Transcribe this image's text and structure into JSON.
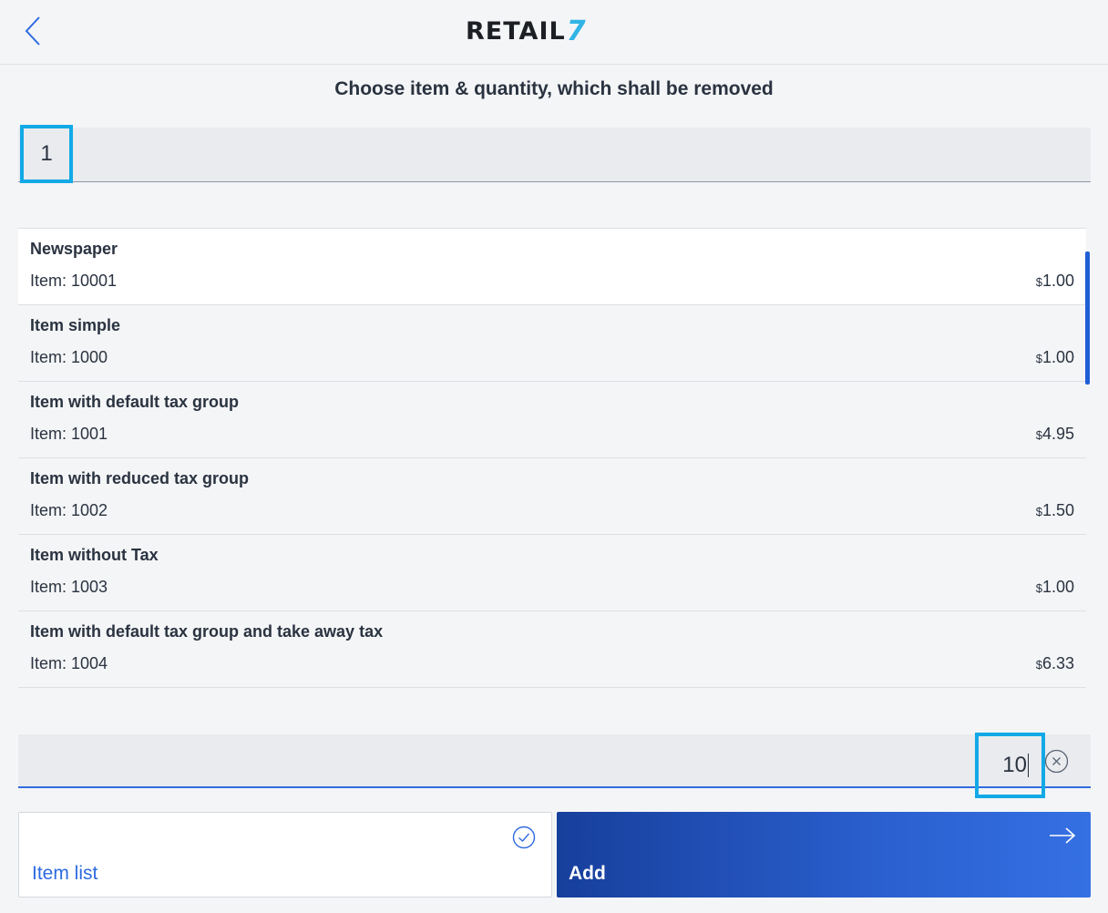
{
  "header": {
    "logo_text": "RETAIL",
    "logo_seven": "7"
  },
  "title": "Choose item & quantity, which shall be removed",
  "search": {
    "value": "1"
  },
  "items": [
    {
      "name": "Newspaper",
      "item": "Item: 10001",
      "currency": "$",
      "price": "1.00",
      "selected": true
    },
    {
      "name": "Item simple",
      "item": "Item: 1000",
      "currency": "$",
      "price": "1.00",
      "selected": false
    },
    {
      "name": "Item with default tax group",
      "item": "Item: 1001",
      "currency": "$",
      "price": "4.95",
      "selected": false
    },
    {
      "name": "Item with reduced tax group",
      "item": "Item: 1002",
      "currency": "$",
      "price": "1.50",
      "selected": false
    },
    {
      "name": "Item without Tax",
      "item": "Item: 1003",
      "currency": "$",
      "price": "1.00",
      "selected": false
    },
    {
      "name": "Item with default tax group and take away tax",
      "item": "Item: 1004",
      "currency": "$",
      "price": "6.33",
      "selected": false
    }
  ],
  "quantity": {
    "value": "10"
  },
  "buttons": {
    "item_list_label": "Item list",
    "add_label": "Add"
  },
  "colors": {
    "accent": "#2f6be0",
    "highlight_border": "#12a9e6",
    "add_button_start": "#173f9c",
    "add_button_end": "#3570e3"
  },
  "icons": {
    "back": "chevron-left-icon",
    "clear": "close-circle-icon",
    "item_list": "check-circle-icon",
    "add": "arrow-right-icon"
  }
}
